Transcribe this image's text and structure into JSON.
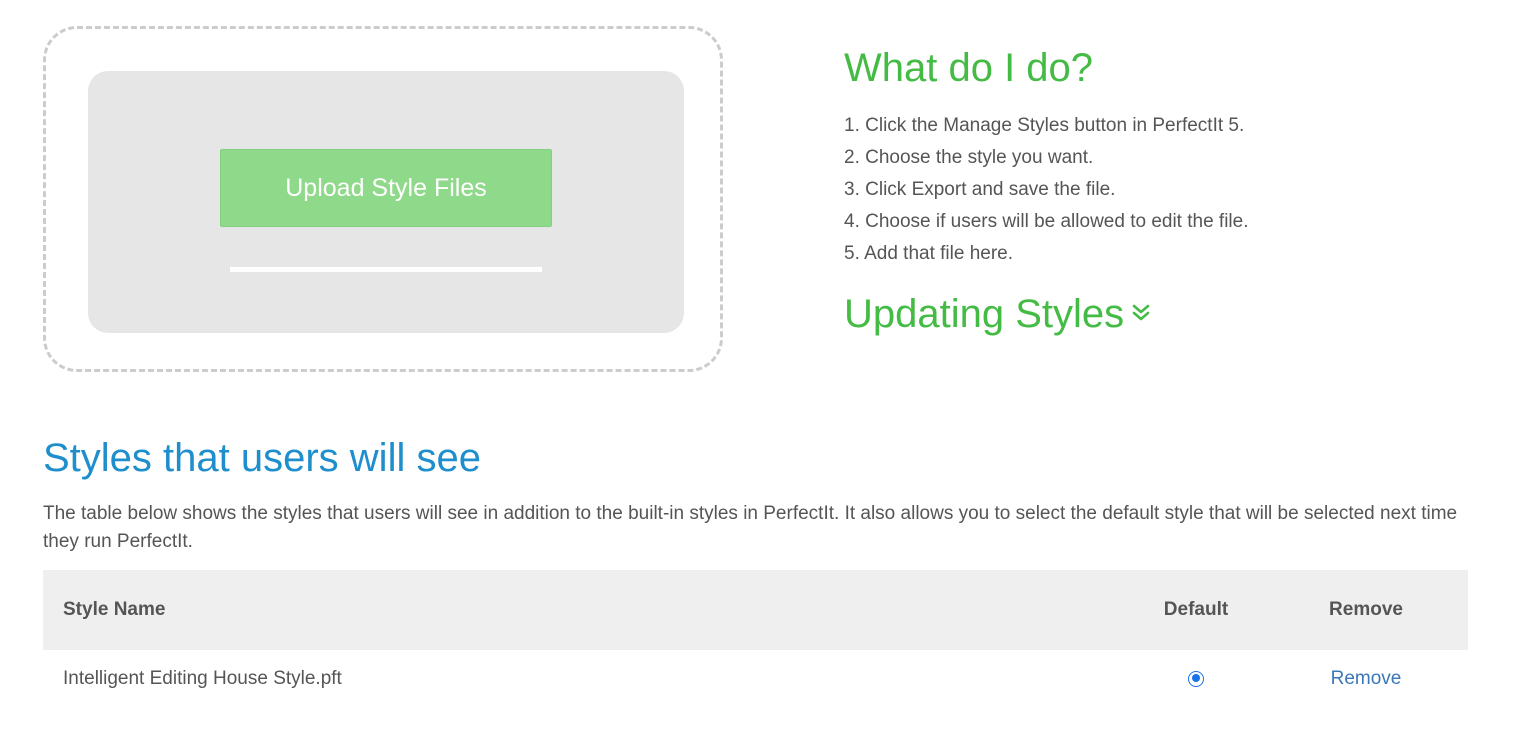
{
  "upload": {
    "button_label": "Upload Style Files",
    "progress_percent": 0
  },
  "help": {
    "title": "What do I do?",
    "steps": [
      "1. Click the Manage Styles button in PerfectIt 5.",
      "2. Choose the style you want.",
      "3. Click Export and save the file.",
      "4. Choose if users will be allowed to edit the file.",
      "5. Add that file here."
    ],
    "updating_label": "Updating Styles",
    "updating_icon": "double-chevron-down-icon"
  },
  "styles": {
    "title": "Styles that users will see",
    "description": "The table below shows the styles that users will see in addition to the built-in styles in PerfectIt. It also allows you to select the default style that will be selected next time they run PerfectIt.",
    "columns": {
      "name": "Style Name",
      "default": "Default",
      "remove": "Remove"
    },
    "rows": [
      {
        "name": "Intelligent Editing House Style.pft",
        "is_default": true,
        "remove_label": "Remove"
      }
    ]
  },
  "colors": {
    "green_heading": "#44bb44",
    "blue_heading": "#1e8fcc",
    "upload_button": "#8fd98a",
    "link": "#3b78b7",
    "radio": "#1a73e8"
  }
}
